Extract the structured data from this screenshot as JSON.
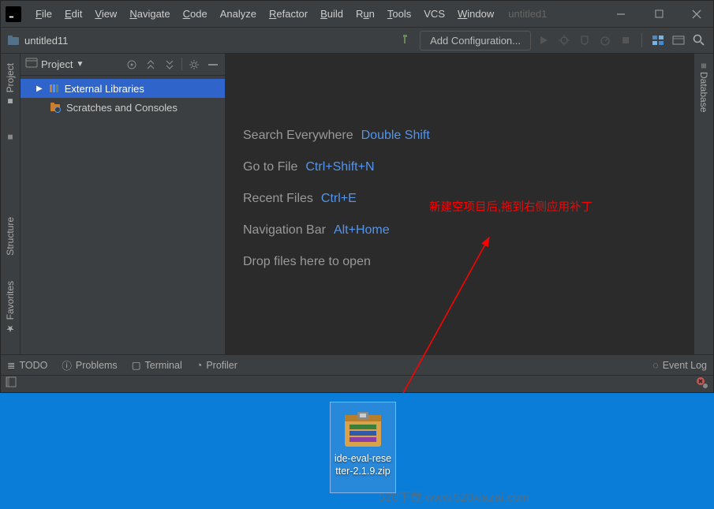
{
  "menu": {
    "file": "File",
    "edit": "Edit",
    "view": "View",
    "navigate": "Navigate",
    "code": "Code",
    "analyze": "Analyze",
    "refactor": "Refactor",
    "build": "Build",
    "run": "Run",
    "tools": "Tools",
    "vcs": "VCS",
    "window": "Window"
  },
  "title_faded": "untitled1",
  "breadcrumb": "untitled11",
  "add_config": "Add Configuration...",
  "panel": {
    "title": "Project"
  },
  "tree": {
    "ext_libs": "External Libraries",
    "scratches": "Scratches and Consoles"
  },
  "left_rail": {
    "project": "Project",
    "structure": "Structure",
    "favorites": "Favorites"
  },
  "right_rail": {
    "database": "Database"
  },
  "hints": {
    "search_label": "Search Everywhere",
    "search_key": "Double Shift",
    "gotofile_label": "Go to File",
    "gotofile_key": "Ctrl+Shift+N",
    "recent_label": "Recent Files",
    "recent_key": "Ctrl+E",
    "navbar_label": "Navigation Bar",
    "navbar_key": "Alt+Home",
    "drop": "Drop files here to open"
  },
  "annotation": "新建空项目后,拖到右侧应用补丁",
  "bottom": {
    "todo": "TODO",
    "problems": "Problems",
    "terminal": "Terminal",
    "profiler": "Profiler",
    "eventlog": "Event Log"
  },
  "desktop_file": "ide-eval-resetter-2.1.9.zip",
  "watermark": "520下载 www.520xiazai.com",
  "colors": {
    "accent": "#5394ec",
    "selection": "#2f65ca",
    "bg_dark": "#2b2b2b",
    "bg_panel": "#3c3f41"
  }
}
